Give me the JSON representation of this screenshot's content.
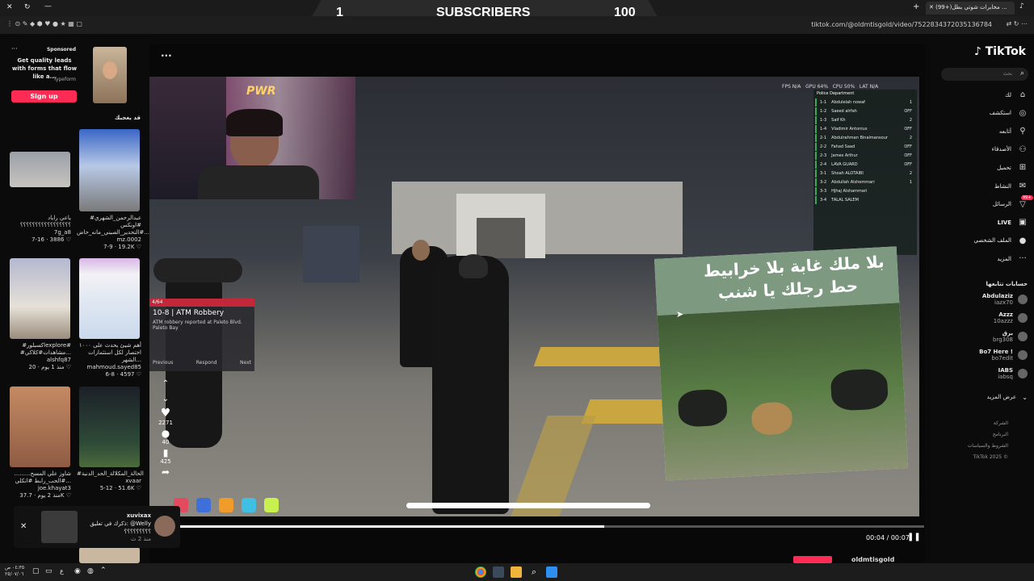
{
  "overlay": {
    "left_count": "1",
    "label": "SUBSCRIBERS",
    "right_count": "100"
  },
  "browser": {
    "url": "tiktok.com/@oldmtisgold/video/7522834372035136784",
    "tab_title": "(99+)مخابرات شوتي بطل ..."
  },
  "sponsored": {
    "label": "Sponsored",
    "text": "Get quality leads with forms that flow like a...",
    "brand": "Typeform",
    "button": "Sign up"
  },
  "you_may_like": "قد يعجبك",
  "grid": [
    {
      "caption": "ياعي راياد ؟؟؟؟؟؟؟؟؟؟؟؟؟؟؟؟؟",
      "user": "7g_a8",
      "date": "7-16",
      "likes": "3886"
    },
    {
      "caption": "#عبدالرحمن_الشهري #اونكس #التحدير_الصيني_مانه_حاض...",
      "user": "mz.0002",
      "date": "7-9",
      "likes": "19.2K"
    },
    {
      "caption": "#اكسبلورexplore# #مشاهدات#كلاكي...",
      "user": "alshfq87",
      "date": "منذ 1 يوم",
      "likes": "20"
    },
    {
      "caption": "أهم شيئ يحدث على ١٠٠٠ اختصار لكل استثمارات الشهر...",
      "user": "mahmoud.sayed85",
      "date": "6-8",
      "likes": "4597"
    },
    {
      "caption": "شاوز علي المسح......... #الحب_رابط #انكلي...",
      "user": "joe.khayat3",
      "date": "منذ 2 يوم",
      "likes": "37.7K"
    },
    {
      "caption": "#الحالة_المكلالة_الحد_الدنية",
      "user": "xvaar",
      "date": "5-12",
      "likes": "51.6K"
    }
  ],
  "notification": {
    "user": "xuvixax",
    "text": "ذكرك في تعليق: @Welly",
    "sub": "؟؟؟؟؟؟؟؟؟",
    "time": "منذ 2 ث"
  },
  "video": {
    "more": "...",
    "time": "00:04 / 00:07",
    "progress": 0.57,
    "likes": "2271",
    "comments": "40",
    "saves": "425",
    "author": "oldmtisgold",
    "hud": "FPS N/A   GPU 64%   CPU 50%   LAT N/A",
    "alert_id": "10-8 | ATM Robbery",
    "alert_text": "ATM robbery reported at Paleto Blvd.",
    "alert_loc": "Paleto Bay",
    "alert_prev": "Previous",
    "alert_respond": "Respond",
    "alert_next": "Next",
    "alert_code": "4/64",
    "meme_text1": "بلا ملك غابة بلا خرابيط",
    "meme_text2": "حط رجلك يا شنب",
    "dept_title": "Police Department",
    "roster": [
      {
        "id": "1-1",
        "name": "Abdulelah nowaf",
        "st": "1"
      },
      {
        "id": "1-2",
        "name": "Saeed alrfah",
        "st": "OFF"
      },
      {
        "id": "1-3",
        "name": "Saif Kh",
        "st": "2"
      },
      {
        "id": "1-4",
        "name": "Vladimir Antonius",
        "st": "OFF"
      },
      {
        "id": "2-1",
        "name": "Abdulrahman Binalmansour",
        "st": "2"
      },
      {
        "id": "2-2",
        "name": "Fahad Saad",
        "st": "OFF"
      },
      {
        "id": "2-3",
        "name": "James Arthur",
        "st": "OFF"
      },
      {
        "id": "2-4",
        "name": "LAVA GUARD",
        "st": "OFF"
      },
      {
        "id": "3-1",
        "name": "Shoah ALOTAIBI",
        "st": "2"
      },
      {
        "id": "3-2",
        "name": "Abdullah Alshemmari",
        "st": "1"
      },
      {
        "id": "3-3",
        "name": "Hjhaj Alshammari",
        "st": ""
      },
      {
        "id": "3-4",
        "name": "TALAL SALEM",
        "st": ""
      }
    ]
  },
  "sidebar": {
    "logo": "TikTok",
    "search_placeholder": "بحث",
    "nav": [
      {
        "label": "لك",
        "icon": "home-icon"
      },
      {
        "label": "استكشف",
        "icon": "compass-icon"
      },
      {
        "label": "أتابعه",
        "icon": "user-follow-icon"
      },
      {
        "label": "الأصدقاء",
        "icon": "friends-icon"
      },
      {
        "label": "تحميل",
        "icon": "upload-icon"
      },
      {
        "label": "النشاط",
        "icon": "activity-icon"
      },
      {
        "label": "الرسائل",
        "icon": "message-icon",
        "badge": "99+"
      },
      {
        "label": "LIVE",
        "icon": "live-icon"
      },
      {
        "label": "الملف الشخصي",
        "icon": "profile-icon"
      },
      {
        "label": "المزيد",
        "icon": "more-icon"
      }
    ],
    "following_title": "حسابات تتابعها",
    "accounts": [
      {
        "name": "Abdulaziz",
        "handle": "iazx70"
      },
      {
        "name": "Azzz",
        "handle": "10azzz"
      },
      {
        "name": "برق",
        "handle": "brg308"
      },
      {
        "name": "Bo7 Here !",
        "handle": "bo7edit"
      },
      {
        "name": "IABS",
        "handle": "iabsq"
      }
    ],
    "see_more": "عرض المزيد",
    "footer": [
      "الشركة",
      "البرنامج",
      "الشروط والسياسات",
      "TikTok 2025 ©"
    ]
  },
  "taskbar": {
    "time": "٠٤:٣٥ ص",
    "date": "٢٥/٠٧/٠٦",
    "lang": "ع"
  }
}
